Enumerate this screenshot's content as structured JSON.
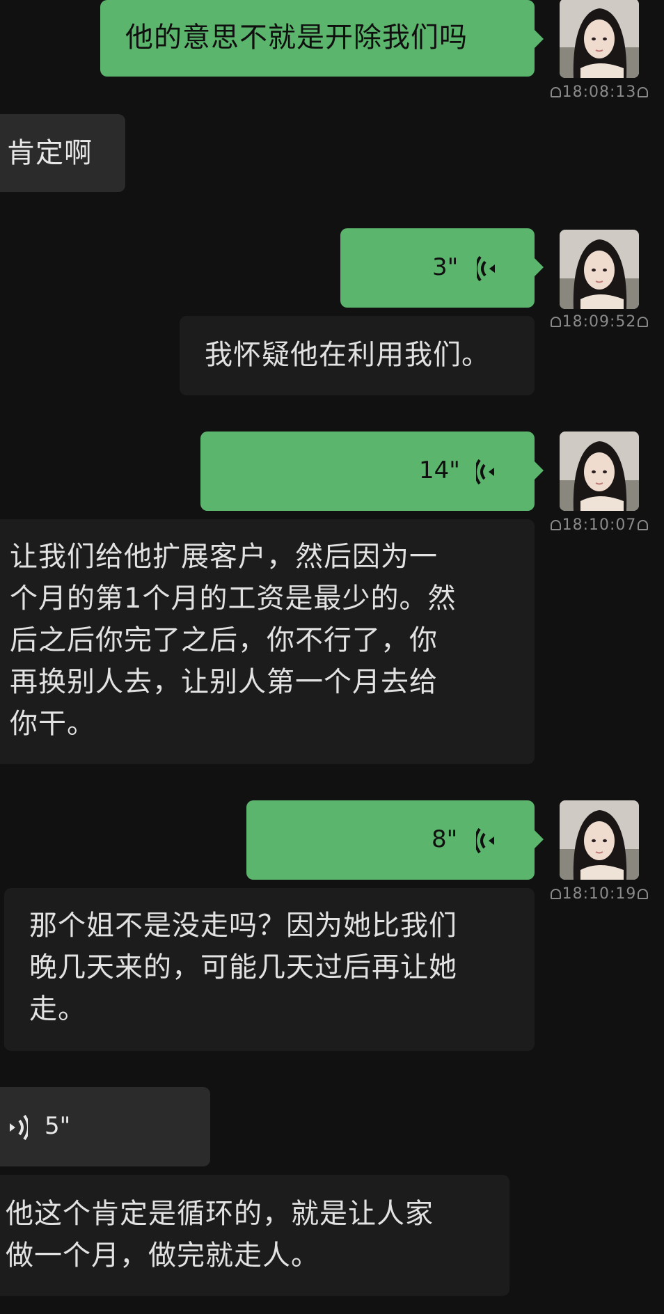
{
  "messages": [
    {
      "side": "out",
      "type": "text",
      "text": "他的意思不就是开除我们吗",
      "timestamp": "18:08:13"
    },
    {
      "side": "in",
      "type": "text",
      "text": "肯定啊"
    },
    {
      "side": "out",
      "type": "voice",
      "duration": "3\"",
      "timestamp": "18:09:52"
    },
    {
      "side": "in",
      "type": "transcript",
      "text": "我怀疑他在利用我们。"
    },
    {
      "side": "out",
      "type": "voice",
      "duration": "14\"",
      "timestamp": "18:10:07"
    },
    {
      "side": "in",
      "type": "transcript",
      "lines": [
        "让我们给他扩展客户，然后因为一",
        "个月的第1个月的工资是最少的。然",
        "后之后你完了之后，你不行了，你",
        "再换别人去，让别人第一个月去给",
        "你干。"
      ]
    },
    {
      "side": "out",
      "type": "voice",
      "duration": "8\"",
      "timestamp": "18:10:19"
    },
    {
      "side": "in",
      "type": "transcript",
      "lines": [
        "那个姐不是没走吗？因为她比我们",
        "晚几天来的，可能几天过后再让她",
        "走。"
      ]
    },
    {
      "side": "in",
      "type": "voice",
      "duration": "5\""
    },
    {
      "side": "in",
      "type": "transcript",
      "lines": [
        "他这个肯定是循环的，就是让人家",
        "做一个月，做完就走人。"
      ]
    }
  ],
  "colors": {
    "background": "#111111",
    "outgoing": "#5cb56c",
    "incoming": "#2b2b2b",
    "transcript": "#1c1c1c"
  },
  "icons": {
    "avatar": "avatar-girl-photo",
    "voice": "voice-wave-icon",
    "lock": "lock-icon"
  }
}
